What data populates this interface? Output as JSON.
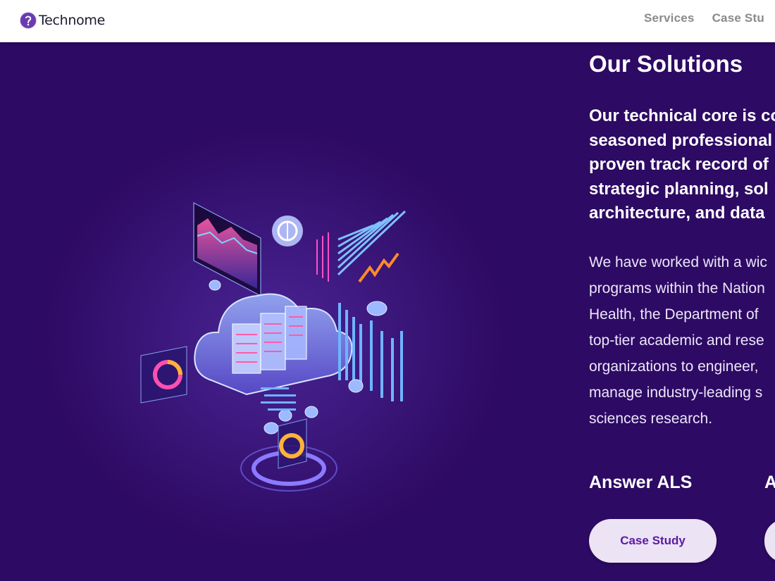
{
  "header": {
    "logo_text": "Technome",
    "nav": [
      "Services",
      "Case Stu"
    ]
  },
  "illustration": {
    "name": "cloud-data-illustration"
  },
  "content": {
    "title": "Our Solutions",
    "lead_lines": [
      "Our technical core is co",
      "seasoned professional",
      "proven track record of",
      "strategic planning, sol",
      "architecture, and data"
    ],
    "body_lines": [
      "We have worked with a wic",
      "programs within the Nation",
      "Health, the Department of",
      "top-tier academic and rese",
      "organizations to engineer,",
      "manage industry-leading s",
      "sciences research."
    ]
  },
  "projects": [
    {
      "title": "Answer ALS",
      "button": "Case Study"
    },
    {
      "title": "A",
      "button": ""
    }
  ],
  "colors": {
    "background": "#2d0a63",
    "button_bg": "#ece3f4",
    "button_text": "#5b1aa3",
    "nav_text": "#8a8a8a"
  }
}
